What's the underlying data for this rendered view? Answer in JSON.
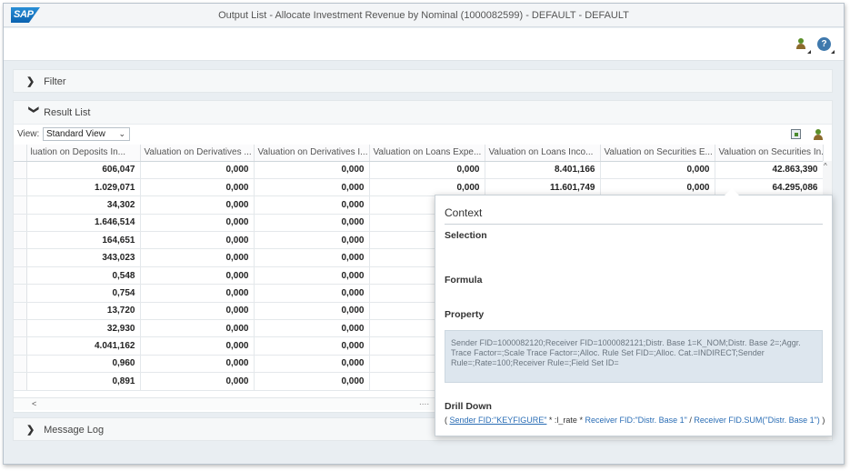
{
  "app": {
    "logo_text": "SAP",
    "title": "Output List - Allocate Investment Revenue by Nominal (1000082599) - DEFAULT - DEFAULT"
  },
  "toolbar": {
    "user_icon": "person-settings-icon",
    "help_icon": "help-icon",
    "help_glyph": "?"
  },
  "filter_panel": {
    "label": "Filter",
    "chevron": "❯"
  },
  "result_panel": {
    "label": "Result List",
    "chevron": "❯",
    "view_label": "View:",
    "view_value": "Standard View",
    "dropdown_glyph": "⌄",
    "columns": [
      "luation on Deposits In...",
      "Valuation on Derivatives ...",
      "Valuation on Derivatives I...",
      "Valuation on Loans Expe...",
      "Valuation on Loans Inco...",
      "Valuation on Securities E...",
      "Valuation on Securities In..."
    ],
    "rows": [
      [
        "606,047",
        "0,000",
        "0,000",
        "0,000",
        "8.401,166",
        "0,000",
        "42.863,390"
      ],
      [
        "1.029,071",
        "0,000",
        "0,000",
        "0,000",
        "11.601,749",
        "0,000",
        "64.295,086"
      ],
      [
        "34,302",
        "0,000",
        "0,000",
        "",
        "",
        "",
        ""
      ],
      [
        "1.646,514",
        "0,000",
        "0,000",
        "",
        "",
        "",
        ""
      ],
      [
        "164,651",
        "0,000",
        "0,000",
        "",
        "",
        "",
        ""
      ],
      [
        "343,023",
        "0,000",
        "0,000",
        "",
        "",
        "",
        ""
      ],
      [
        "0,548",
        "0,000",
        "0,000",
        "",
        "",
        "",
        ""
      ],
      [
        "0,754",
        "0,000",
        "0,000",
        "",
        "",
        "",
        ""
      ],
      [
        "13,720",
        "0,000",
        "0,000",
        "",
        "",
        "",
        ""
      ],
      [
        "32,930",
        "0,000",
        "0,000",
        "",
        "",
        "",
        ""
      ],
      [
        "4.041,162",
        "0,000",
        "0,000",
        "",
        "",
        "",
        ""
      ],
      [
        "0,960",
        "0,000",
        "0,000",
        "",
        "",
        "",
        ""
      ],
      [
        "0,891",
        "0,000",
        "0,000",
        "",
        "",
        "",
        ""
      ]
    ],
    "scroll_up": "^",
    "scroll_left": "<",
    "grip": "...."
  },
  "message_panel": {
    "label": "Message Log",
    "chevron": "❯"
  },
  "context_popover": {
    "title": "Context",
    "selection_label": "Selection",
    "formula_label": "Formula",
    "property_label": "Property",
    "property_text": "Sender FID=1000082120;Receiver FID=1000082121;Distr. Base 1=K_NOM;Distr. Base 2=;Aggr. Trace Factor=;Scale Trace Factor=;Alloc. Rule Set FID=;Alloc. Cat.=INDIRECT;Sender Rule=;Rate=100;Receiver Rule=;Field Set ID=",
    "drill_label": "Drill Down",
    "drill_open": "( ",
    "drill_link": "Sender FID:\"KEYFIGURE\"",
    "drill_rate": " * :l_rate * ",
    "drill_receiver1": "Receiver FID:\"Distr. Base 1\"",
    "drill_div": " / ",
    "drill_receiver2": "Receiver FID.SUM(\"Distr. Base 1\")",
    "drill_close": " )"
  },
  "colors": {
    "brand": "#0a62b0",
    "link": "#2a6db5",
    "panel": "#f6f8f9",
    "property_box": "#dde6ee"
  }
}
